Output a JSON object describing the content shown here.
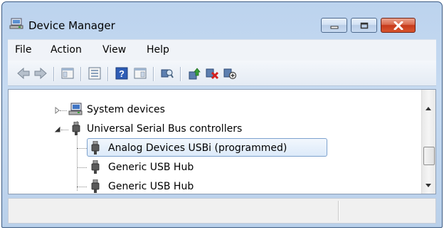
{
  "window": {
    "title": "Device Manager",
    "colors": {
      "frame": "#bcd3ee",
      "close_button": "#c6391b",
      "selection_border": "#7da2ce"
    }
  },
  "caption_buttons": [
    {
      "name": "minimize-button",
      "icon": "minimize-icon"
    },
    {
      "name": "maximize-button",
      "icon": "maximize-icon"
    },
    {
      "name": "close-button",
      "icon": "close-icon"
    }
  ],
  "menu": {
    "file": "File",
    "action": "Action",
    "view": "View",
    "help": "Help"
  },
  "toolbar": {
    "icons": [
      "back-arrow-icon",
      "forward-arrow-icon",
      "show-hide-tree-icon",
      "properties-icon",
      "help-icon",
      "view-icon",
      "scan-hardware-icon",
      "update-driver-icon",
      "uninstall-icon",
      "disable-device-icon"
    ]
  },
  "tree": {
    "system_devices": "System devices",
    "usb_controllers": "Universal Serial Bus controllers",
    "children": [
      "Analog Devices USBi (programmed)",
      "Generic USB Hub",
      "Generic USB Hub"
    ],
    "selected_index": 0
  },
  "statusbar": {
    "text": ""
  }
}
